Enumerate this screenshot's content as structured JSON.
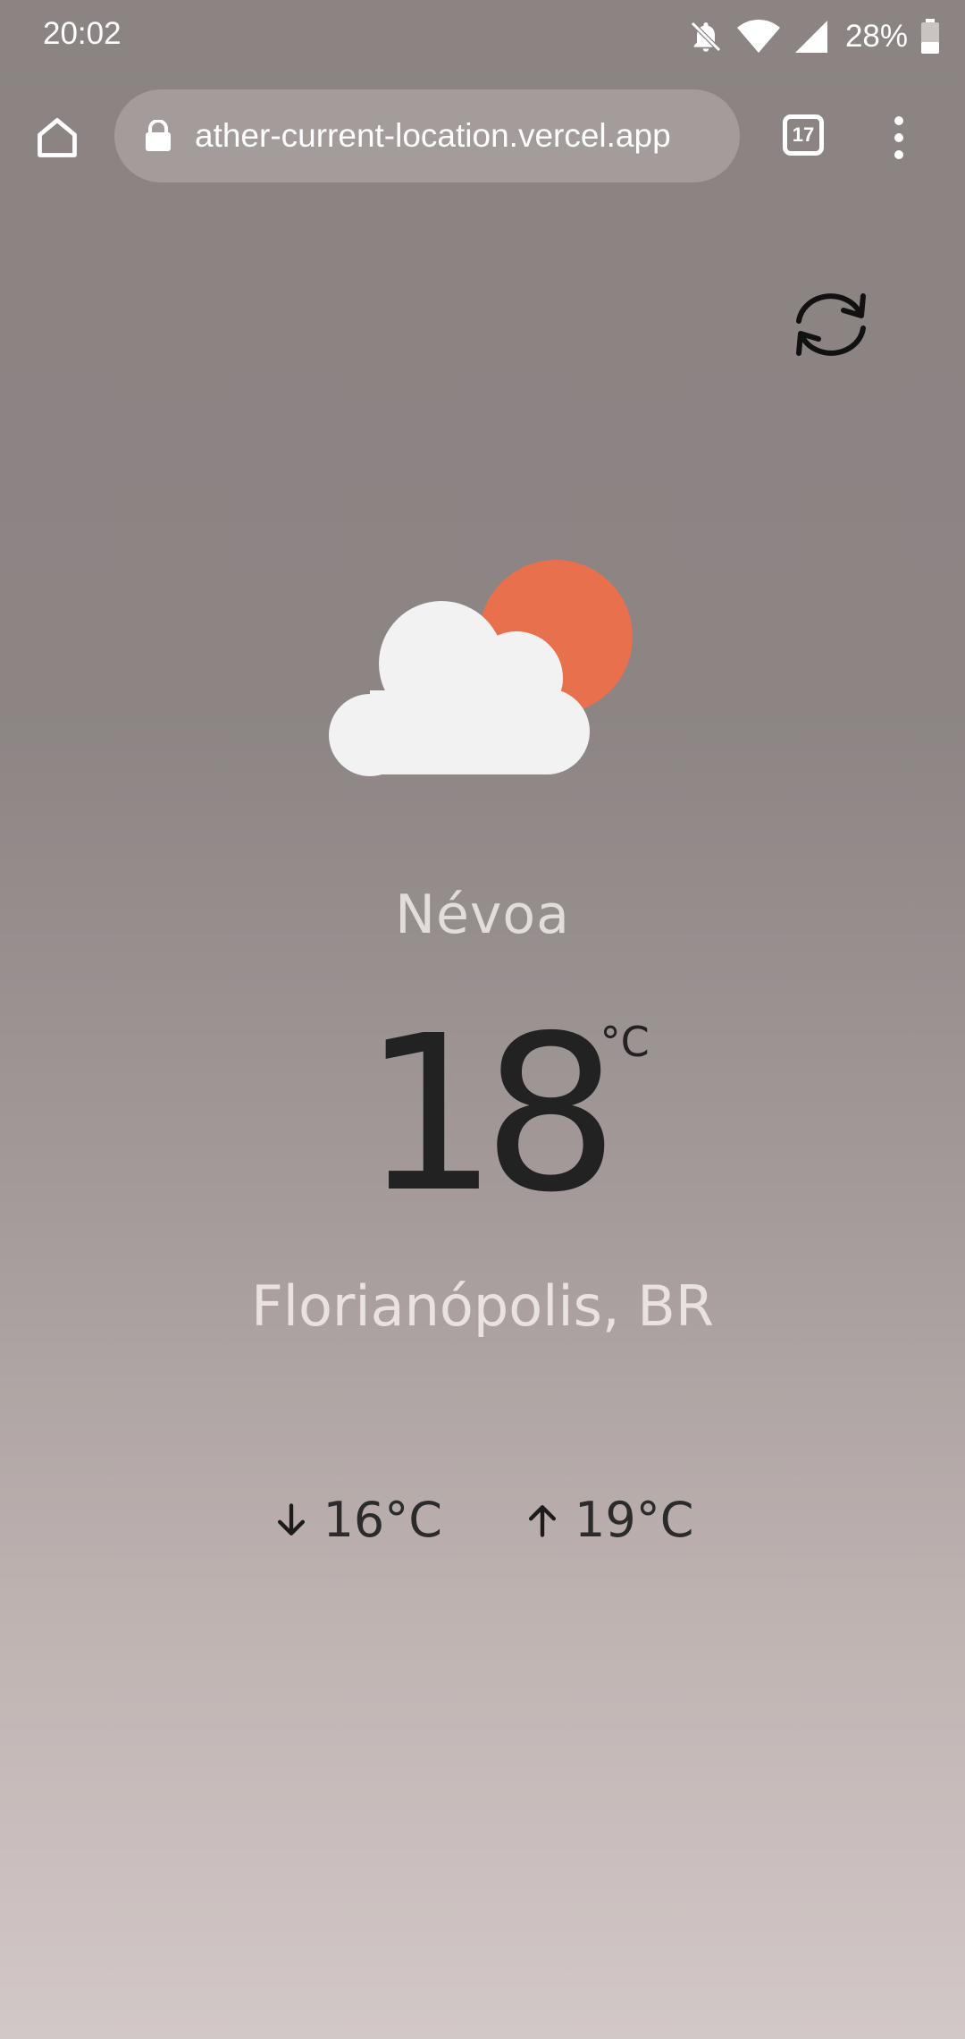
{
  "status_bar": {
    "time": "20:02",
    "battery_percent": "28%",
    "icons": [
      "notifications-off-icon",
      "wifi-icon",
      "cell-signal-icon",
      "battery-icon"
    ]
  },
  "browser": {
    "url_visible": "ather-current-location.vercel.app",
    "tab_count": "17",
    "icons": [
      "home-icon",
      "lock-icon",
      "tabs-icon",
      "more-vert-icon"
    ]
  },
  "weather": {
    "condition": "Névoa",
    "temperature": "18",
    "unit": "°C",
    "location": "Florianópolis, BR",
    "min_temp": "16°C",
    "max_temp": "19°C",
    "icon": "partly-cloudy-icon",
    "refresh_icon": "refresh-icon"
  },
  "colors": {
    "background_top": "#8b8483",
    "background_bottom": "#d2c8c7",
    "sun": "#e8704c",
    "cloud": "#f2f2f2",
    "text_dark": "#222222",
    "text_light": "#e8e2e1"
  }
}
